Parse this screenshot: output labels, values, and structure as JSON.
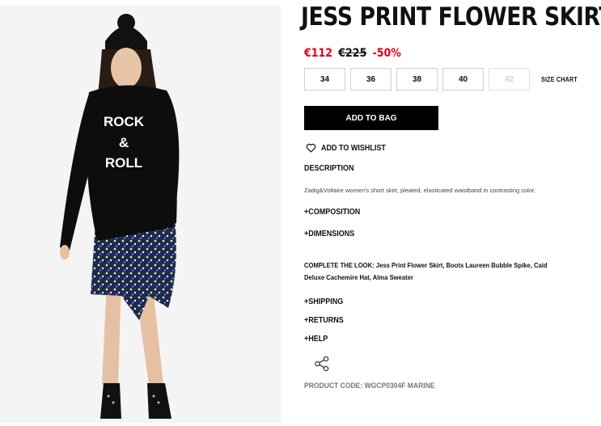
{
  "product": {
    "title": "JESS PRINT FLOWER SKIRT",
    "image_alt": "Model wearing black ROCK & ROLL sweater with floral print skirt",
    "sweater_text": [
      "ROCK",
      "&",
      "ROLL"
    ],
    "price": {
      "current": "€112",
      "original": "€225",
      "discount": "-50%"
    },
    "sizes": [
      {
        "label": "34",
        "available": true
      },
      {
        "label": "36",
        "available": true
      },
      {
        "label": "38",
        "available": true
      },
      {
        "label": "40",
        "available": true
      },
      {
        "label": "42",
        "available": false
      }
    ],
    "size_chart_label": "SIZE CHART",
    "add_to_bag_label": "ADD TO BAG",
    "wishlist_label": "ADD TO WISHLIST",
    "description_heading": "DESCRIPTION",
    "description_text": "Zadig&Voltaire women's short skirt, pleated, elasticated waistband in contrasting color.",
    "composition_label": "+COMPOSITION",
    "dimensions_label": "+DIMENSIONS",
    "complete_look_label": "COMPLETE THE LOOK:",
    "complete_look_items": "Jess Print Flower Skirt, Boots Laureen Bubble Spike, Caid Deluxe Cachemire Hat, Alma Sweater",
    "shipping_label": "+SHIPPING",
    "returns_label": "+RETURNS",
    "help_label": "+HELP",
    "share_icon": "share-icon",
    "product_code": "PRODUCT CODE: WGCP0304F MARINE"
  },
  "colors": {
    "accent_red": "#e2001a",
    "button_black": "#000000",
    "muted_gray": "#777777"
  }
}
